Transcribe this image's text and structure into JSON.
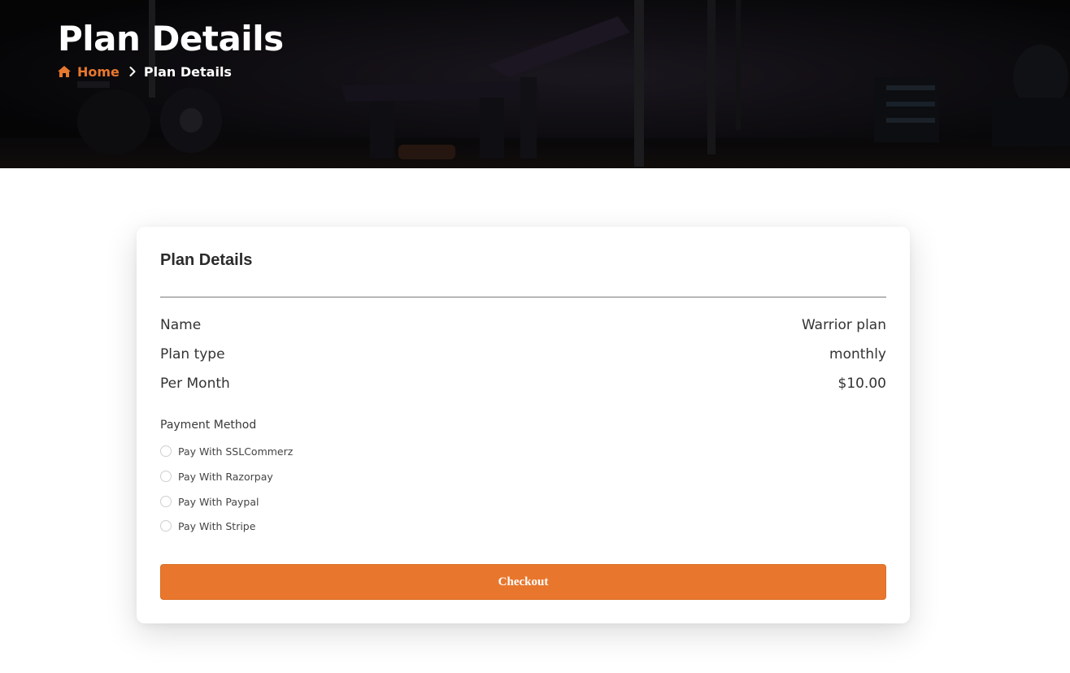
{
  "hero": {
    "title": "Plan Details",
    "breadcrumb": {
      "home": "Home",
      "current": "Plan Details"
    }
  },
  "card": {
    "title": "Plan Details",
    "details": [
      {
        "label": "Name",
        "value": "Warrior plan"
      },
      {
        "label": "Plan type",
        "value": "monthly"
      },
      {
        "label": "Per Month",
        "value": "$10.00"
      }
    ],
    "payment_method_label": "Payment Method",
    "payment_options": [
      {
        "label": "Pay With SSLCommerz",
        "selected": false
      },
      {
        "label": "Pay With Razorpay",
        "selected": false
      },
      {
        "label": "Pay With Paypal",
        "selected": false
      },
      {
        "label": "Pay With Stripe",
        "selected": false
      }
    ],
    "checkout_label": "Checkout"
  },
  "colors": {
    "accent": "#e8772d",
    "hero_background": "#0b0b0e",
    "text": "#2a2a2a"
  },
  "icons": {
    "breadcrumb_home": "home-icon",
    "breadcrumb_separator": "chevron-right-icon"
  }
}
